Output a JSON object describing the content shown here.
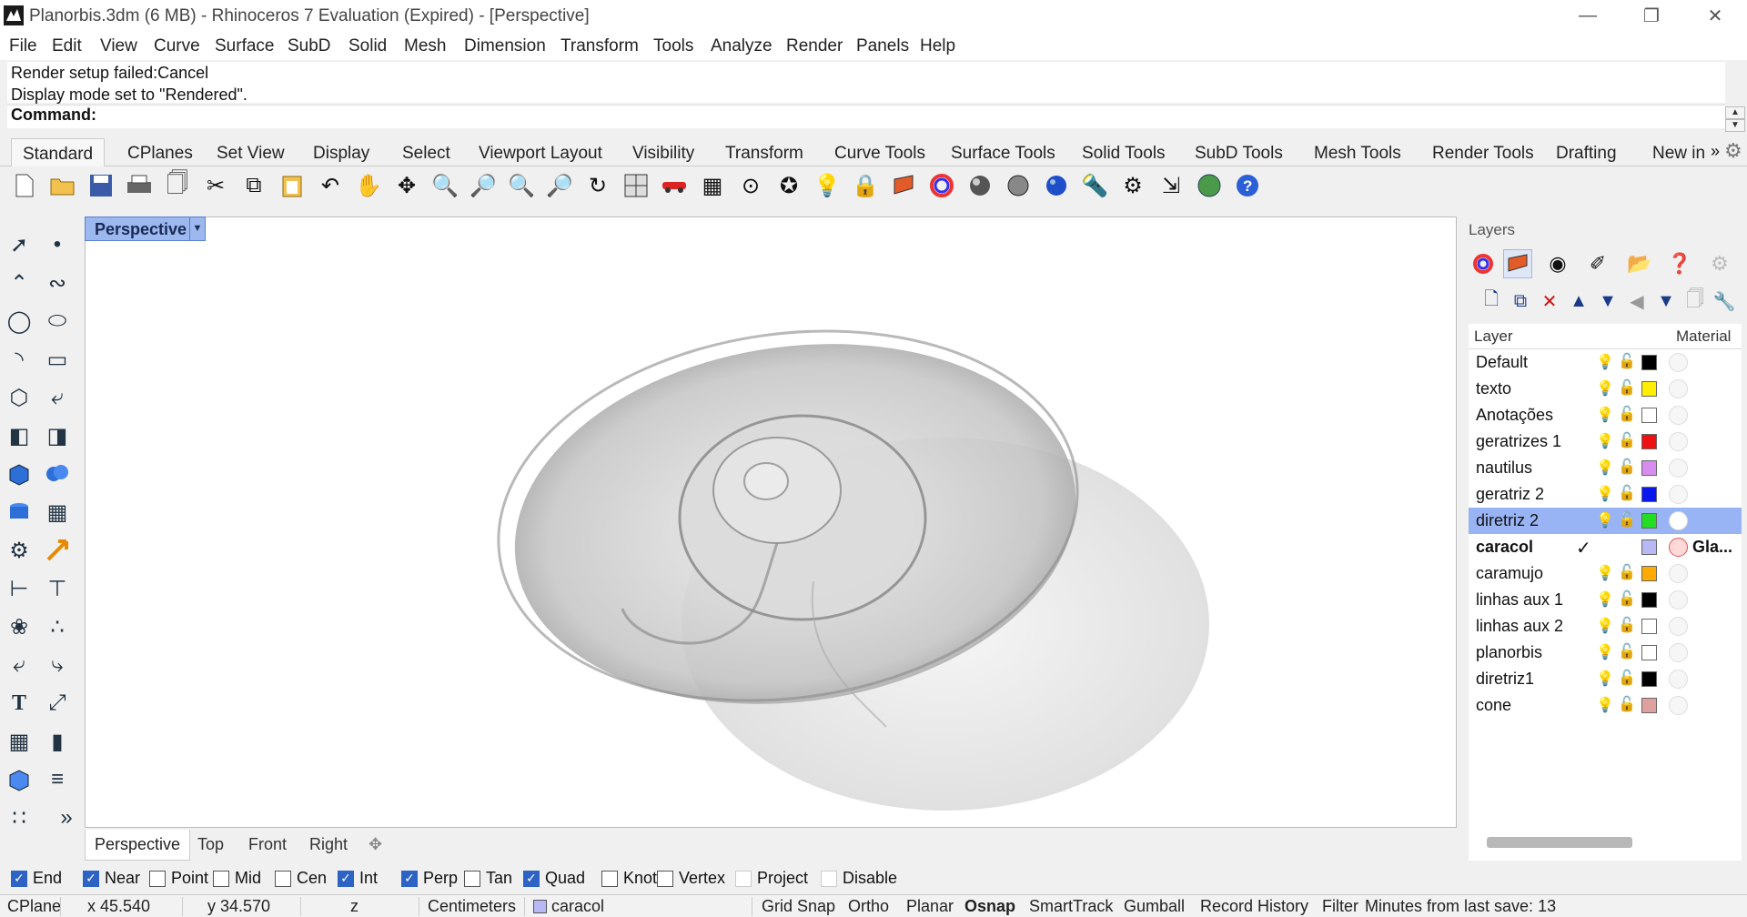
{
  "titlebar": {
    "title": "Planorbis.3dm (6 MB) - Rhinoceros 7 Evaluation (Expired) - [Perspective]"
  },
  "menus": [
    "File",
    "Edit",
    "View",
    "Curve",
    "Surface",
    "SubD",
    "Solid",
    "Mesh",
    "Dimension",
    "Transform",
    "Tools",
    "Analyze",
    "Render",
    "Panels",
    "Help"
  ],
  "command": {
    "history_line1": "Render setup failed:Cancel",
    "history_line2": "Display mode set to \"Rendered\".",
    "prompt": "Command:"
  },
  "toolbar_tabs": [
    "Standard",
    "CPlanes",
    "Set View",
    "Display",
    "Select",
    "Viewport Layout",
    "Visibility",
    "Transform",
    "Curve Tools",
    "Surface Tools",
    "Solid Tools",
    "SubD Tools",
    "Mesh Tools",
    "Render Tools",
    "Drafting",
    "New in"
  ],
  "viewport": {
    "label": "Perspective",
    "tabs": [
      "Perspective",
      "Top",
      "Front",
      "Right"
    ]
  },
  "panel": {
    "title": "Layers",
    "col_layer": "Layer",
    "col_material": "Material",
    "layers": [
      {
        "name": "Default",
        "color": "#000000",
        "bulb": "#e6c000"
      },
      {
        "name": "texto",
        "color": "#ffee00",
        "bulb": "#2a5fd0"
      },
      {
        "name": "Anotações",
        "color": "#ffffff",
        "bulb": "#2a5fd0"
      },
      {
        "name": "geratrizes 1",
        "color": "#ee1111",
        "bulb": "#2a5fd0"
      },
      {
        "name": "nautilus",
        "color": "#d78cf0",
        "bulb": "#2a5fd0"
      },
      {
        "name": "geratriz 2",
        "color": "#0a16ee",
        "bulb": "#2a5fd0"
      },
      {
        "name": "diretriz 2",
        "color": "#22dd22",
        "bulb": "#2a5fd0",
        "selected": true
      },
      {
        "name": "caracol",
        "color": "#b8b8f4",
        "current": true,
        "check": "✓",
        "material": "Gla..."
      },
      {
        "name": "caramujo",
        "color": "#ffaa00",
        "bulb": "#e6c000"
      },
      {
        "name": "linhas aux 1",
        "color": "#000000",
        "bulb": "#2a5fd0"
      },
      {
        "name": "linhas aux 2",
        "color": "#ffffff",
        "bulb": "#2a5fd0"
      },
      {
        "name": "planorbis",
        "color": "#ffffff",
        "bulb": "#2a5fd0"
      },
      {
        "name": "diretriz1",
        "color": "#000000",
        "bulb": "#2a5fd0"
      },
      {
        "name": "cone",
        "color": "#e0a0a0",
        "bulb": "#2a5fd0"
      }
    ]
  },
  "osnaps": [
    {
      "label": "End",
      "on": true
    },
    {
      "label": "Near",
      "on": true
    },
    {
      "label": "Point",
      "on": false
    },
    {
      "label": "Mid",
      "on": false
    },
    {
      "label": "Cen",
      "on": false
    },
    {
      "label": "Int",
      "on": true
    },
    {
      "label": "Perp",
      "on": true
    },
    {
      "label": "Tan",
      "on": false
    },
    {
      "label": "Quad",
      "on": true
    },
    {
      "label": "Knot",
      "on": false
    },
    {
      "label": "Vertex",
      "on": false
    },
    {
      "label": "Project",
      "on": false
    },
    {
      "label": "Disable",
      "on": false
    }
  ],
  "status": {
    "cplane": "CPlane",
    "x": "x 45.540",
    "y": "y 34.570",
    "z": "z",
    "units": "Centimeters",
    "layer": "caracol",
    "grid_snap": "Grid Snap",
    "ortho": "Ortho",
    "planar": "Planar",
    "osnap": "Osnap",
    "smarttrack": "SmartTrack",
    "gumball": "Gumball",
    "record_history": "Record History",
    "filter": "Filter",
    "save_info": "Minutes from last save: 13"
  },
  "colors": {
    "accent": "#2c63c5",
    "selection": "#99b4f4",
    "viewport_label": "#9db8ef"
  }
}
